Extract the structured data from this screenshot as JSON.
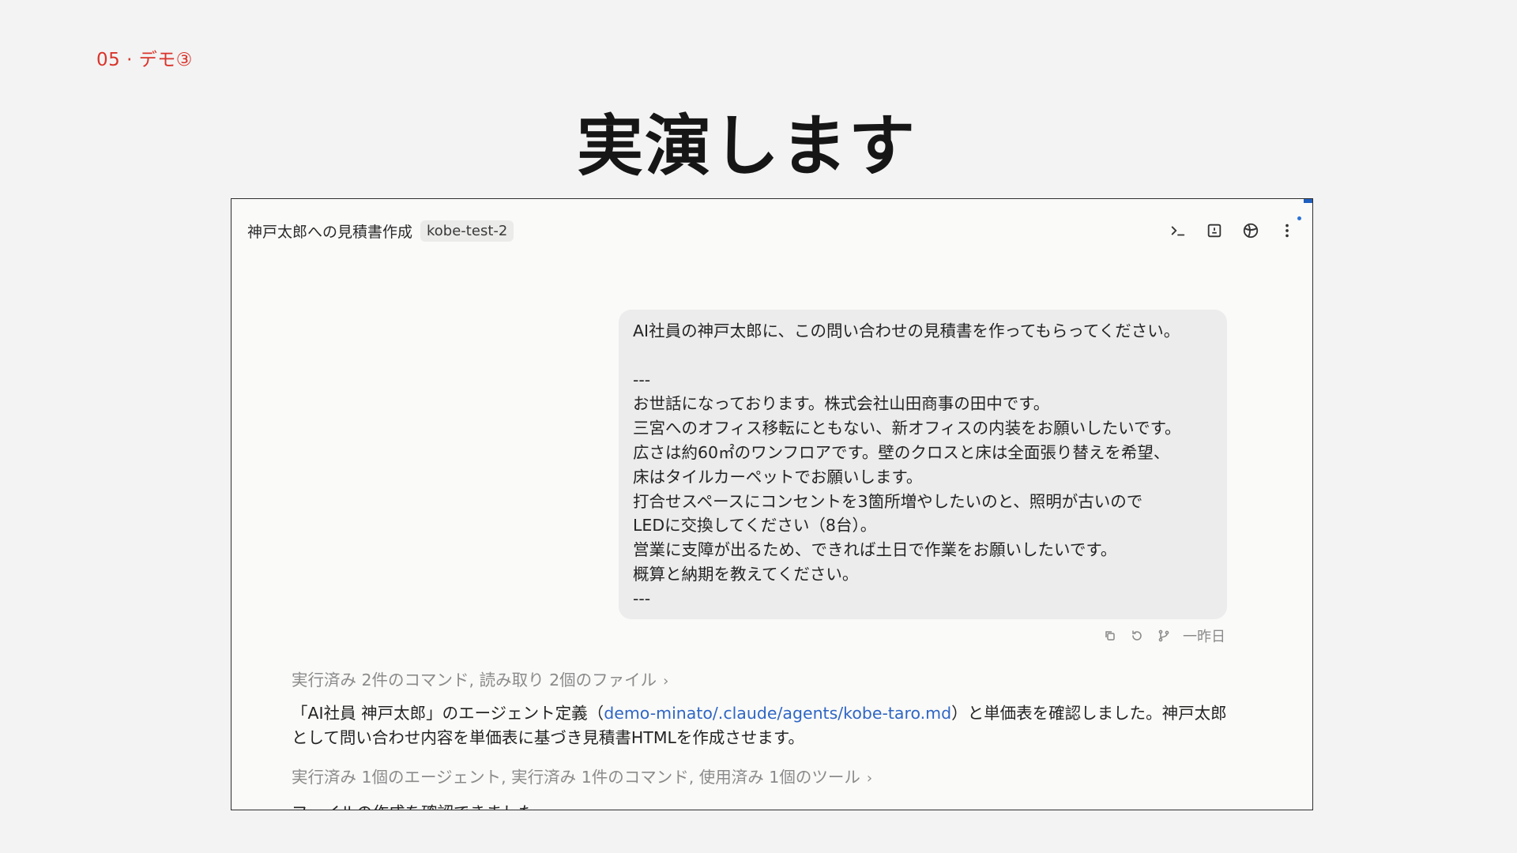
{
  "slide": {
    "section_label": "05 · デモ③",
    "title": "実演します"
  },
  "window": {
    "title": "神戸太郎への見積書作成",
    "branch": "kobe-test-2",
    "toolbar_icons": [
      "terminal-icon",
      "panel-icon",
      "globe-icon",
      "more-vertical-icon"
    ]
  },
  "user_message": {
    "lines": [
      "AI社員の神戸太郎に、この問い合わせの見積書を作ってもらってください。",
      "",
      "---",
      "お世話になっております。株式会社山田商事の田中です。",
      "三宮へのオフィス移転にともない、新オフィスの内装をお願いしたいです。",
      "広さは約60㎡のワンフロアです。壁のクロスと床は全面張り替えを希望、",
      "床はタイルカーペットでお願いします。",
      "打合せスペースにコンセントを3箇所増やしたいのと、照明が古いので",
      "LEDに交換してください（8台）。",
      "営業に支障が出るため、できれば土日で作業をお願いしたいです。",
      "概算と納期を教えてください。",
      "---"
    ],
    "timestamp": "一昨日",
    "action_icons": [
      "copy-icon",
      "retry-icon",
      "branch-icon"
    ]
  },
  "assistant": {
    "activity_1": "実行済み 2件のコマンド, 読み取り 2個のファイル",
    "reply_prefix": "「AI社員 神戸太郎」のエージェント定義（",
    "reply_link": "demo-minato/.claude/agents/kobe-taro.md",
    "reply_suffix": "）と単価表を確認しました。神戸太郎として問い合わせ内容を単価表に基づき見積書HTMLを作成させます。",
    "activity_2": "実行済み 1個のエージェント, 実行済み 1件のコマンド, 使用済み 1個のツール",
    "cutoff_line": "ファイルの作成を確認できました。"
  },
  "colors": {
    "accent_red": "#d9342b",
    "link_blue": "#2f66c4",
    "bubble_bg": "#ececec",
    "page_bg": "#f3f3f3"
  }
}
